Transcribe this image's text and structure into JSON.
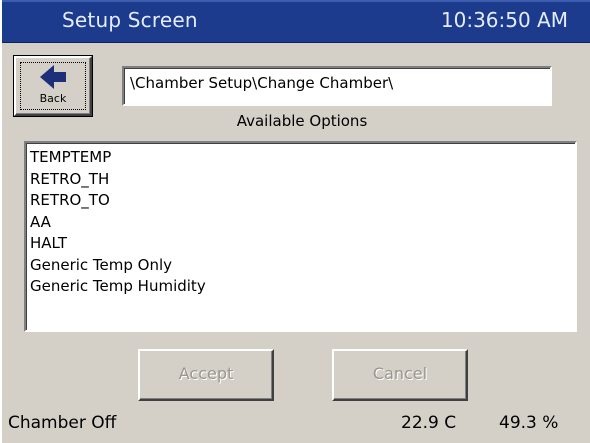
{
  "header": {
    "title": "Setup Screen",
    "clock": "10:36:50 AM"
  },
  "toolbar": {
    "back_label": "Back",
    "back_icon": "left-arrow-icon"
  },
  "path": {
    "value": "\\Chamber Setup\\Change Chamber\\"
  },
  "options": {
    "label": "Available Options",
    "items": [
      "TEMPTEMP",
      "RETRO_TH",
      "RETRO_TO",
      "AA",
      "HALT",
      "Generic Temp Only",
      "Generic Temp Humidity"
    ]
  },
  "actions": {
    "accept_label": "Accept",
    "cancel_label": "Cancel"
  },
  "status": {
    "chamber_state": "Chamber Off",
    "temperature": "22.9 C",
    "humidity": "49.3 %"
  },
  "colors": {
    "titlebar": "#1c3b8c",
    "background": "#d4d0c8",
    "disabled_text": "#9a968f"
  }
}
